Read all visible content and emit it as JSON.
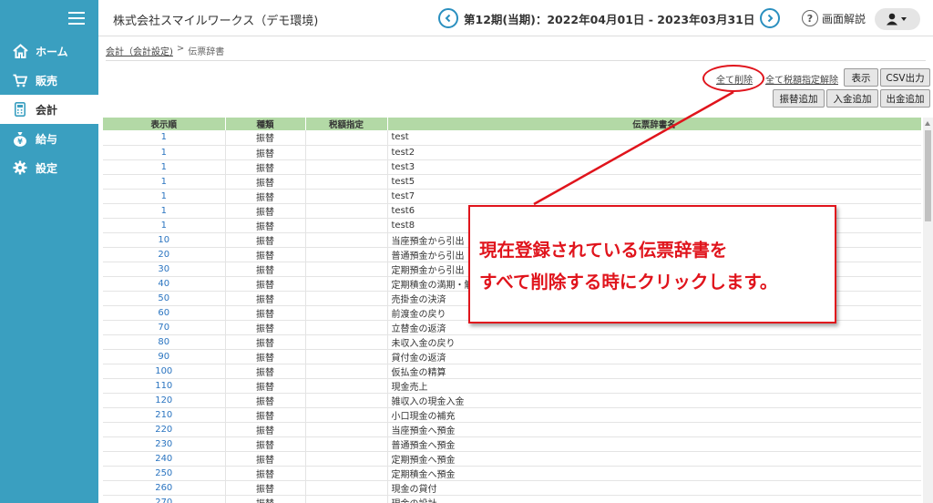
{
  "sidebar": {
    "items": [
      {
        "label": "ホーム",
        "icon": "home-icon"
      },
      {
        "label": "販売",
        "icon": "cart-icon"
      },
      {
        "label": "会計",
        "icon": "calculator-icon"
      },
      {
        "label": "給与",
        "icon": "money-bag-icon"
      },
      {
        "label": "設定",
        "icon": "gear-icon"
      }
    ],
    "active_index": 2
  },
  "header": {
    "company": "株式会社スマイルワークス（デモ環境)",
    "period": "第12期(当期)：2022年04月01日 - 2023年03月31日",
    "help_label": "画面解説"
  },
  "breadcrumb": {
    "parent": "会計（会計設定)",
    "separator": ">",
    "current": "伝票辞書"
  },
  "toolbar": {
    "delete_all": "全て削除",
    "clear_tax": "全て税額指定解除",
    "show": "表示",
    "csv": "CSV出力",
    "add_transfer": "振替追加",
    "add_deposit": "入金追加",
    "add_withdrawal": "出金追加"
  },
  "table": {
    "headers": [
      "表示順",
      "種類",
      "税額指定",
      "伝票辞書名"
    ],
    "rows": [
      [
        "1",
        "振替",
        "",
        "test"
      ],
      [
        "1",
        "振替",
        "",
        "test2"
      ],
      [
        "1",
        "振替",
        "",
        "test3"
      ],
      [
        "1",
        "振替",
        "",
        "test5"
      ],
      [
        "1",
        "振替",
        "",
        "test7"
      ],
      [
        "1",
        "振替",
        "",
        "test6"
      ],
      [
        "1",
        "振替",
        "",
        "test8"
      ],
      [
        "10",
        "振替",
        "",
        "当座預金から引出"
      ],
      [
        "20",
        "振替",
        "",
        "普通預金から引出"
      ],
      [
        "30",
        "振替",
        "",
        "定期預金から引出"
      ],
      [
        "40",
        "振替",
        "",
        "定期積金の満期・解約"
      ],
      [
        "50",
        "振替",
        "",
        "売掛金の決済"
      ],
      [
        "60",
        "振替",
        "",
        "前渡金の戻り"
      ],
      [
        "70",
        "振替",
        "",
        "立替金の返済"
      ],
      [
        "80",
        "振替",
        "",
        "未収入金の戻り"
      ],
      [
        "90",
        "振替",
        "",
        "貸付金の返済"
      ],
      [
        "100",
        "振替",
        "",
        "仮払金の精算"
      ],
      [
        "110",
        "振替",
        "",
        "現金売上"
      ],
      [
        "120",
        "振替",
        "",
        "雑収入の現金入金"
      ],
      [
        "210",
        "振替",
        "",
        "小口現金の補充"
      ],
      [
        "220",
        "振替",
        "",
        "当座預金へ預金"
      ],
      [
        "230",
        "振替",
        "",
        "普通預金へ預金"
      ],
      [
        "240",
        "振替",
        "",
        "定期預金へ預金"
      ],
      [
        "250",
        "振替",
        "",
        "定期積金へ預金"
      ],
      [
        "260",
        "振替",
        "",
        "現金の貸付"
      ],
      [
        "270",
        "振替",
        "",
        "現金の設計"
      ]
    ]
  },
  "annotation": {
    "line1": "現在登録されている伝票辞書を",
    "line2": "すべて削除する時にクリックします。"
  },
  "colors": {
    "sidebar": "#3a9fc0",
    "table_header": "#b3d9a6",
    "annotation": "#e0141c",
    "link_blue": "#2a74c0"
  }
}
